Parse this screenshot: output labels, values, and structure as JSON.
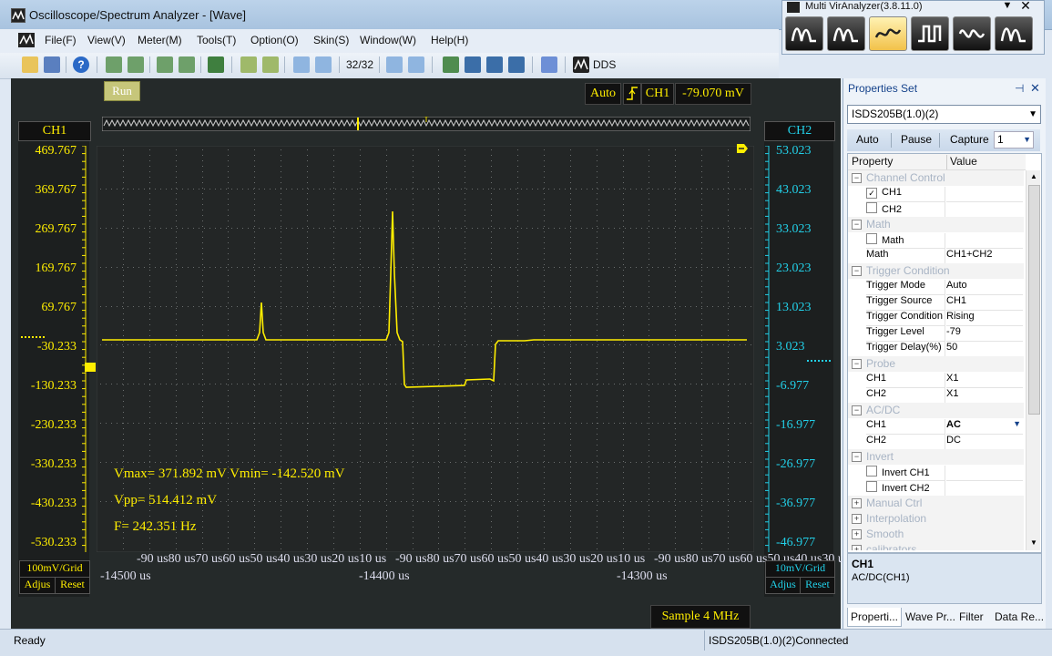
{
  "window": {
    "title": "Oscilloscope/Spectrum Analyzer - [Wave]"
  },
  "menu": [
    "File(F)",
    "View(V)",
    "Meter(M)",
    "Tools(T)",
    "Option(O)",
    "Skin(S)",
    "Window(W)",
    "Help(H)"
  ],
  "toolbar": {
    "page_counter": "32/32",
    "dds_label": "DDS"
  },
  "multivir": {
    "title": "Multi VirAnalyzer(3.8.11.0)"
  },
  "scope": {
    "run_label": "Run",
    "trigger_mode": "Auto",
    "trigger_channel": "CH1",
    "trigger_level": "-79.070 mV",
    "ch1_label": "CH1",
    "ch2_label": "CH2",
    "ch1_scale": [
      "469.767",
      "369.767",
      "269.767",
      "169.767",
      "69.767",
      "-30.233",
      "-130.233",
      "-230.233",
      "-330.233",
      "-430.233",
      "-530.233"
    ],
    "ch2_scale": [
      "53.023",
      "43.023",
      "33.023",
      "23.023",
      "13.023",
      "3.023",
      "-6.977",
      "-16.977",
      "-26.977",
      "-36.977",
      "-46.977"
    ],
    "ch1_grid": "100mV/Grid",
    "ch2_grid": "10mV/Grid",
    "adjust_label": "Adjus",
    "reset_label": "Reset",
    "x_ticks": "-90 us80 us70 us60 us50 us40 us30 us20 us10 us",
    "time_labels": [
      "-14500 us",
      "-14400 us",
      "-14300 us"
    ],
    "vmax_vmin": "Vmax= 371.892 mV  Vmin= -142.520 mV",
    "vpp": "Vpp= 514.412 mV",
    "freq": "F= 242.351 Hz",
    "sample_rate": "Sample 4 MHz",
    "colors": {
      "ch1": "#ffee00",
      "ch2": "#22d0e8",
      "grid_bg": "#232626"
    }
  },
  "properties": {
    "title": "Properties Set",
    "device": "ISDS205B(1.0)(2)",
    "auto_label": "Auto",
    "pause_label": "Pause",
    "capture_label": "Capture",
    "capture_value": "1",
    "col_property": "Property",
    "col_value": "Value",
    "rows": {
      "channel_control": "Channel Control",
      "ch1": "CH1",
      "ch2": "CH2",
      "math_cat": "Math",
      "math_check": "Math",
      "math": "Math",
      "math_val": "CH1+CH2",
      "trigger_cat": "Trigger Condition",
      "trigger_mode": "Trigger Mode",
      "trigger_mode_val": "Auto",
      "trigger_source": "Trigger Source",
      "trigger_source_val": "CH1",
      "trigger_condition": "Trigger Condition",
      "trigger_condition_val": "Rising",
      "trigger_level": "Trigger Level",
      "trigger_level_val": "-79",
      "trigger_delay": "Trigger Delay(%)",
      "trigger_delay_val": "50",
      "probe_cat": "Probe",
      "probe_ch1": "CH1",
      "probe_ch1_val": "X1",
      "probe_ch2": "CH2",
      "probe_ch2_val": "X1",
      "acdc_cat": "AC/DC",
      "acdc_ch1": "CH1",
      "acdc_ch1_val": "AC",
      "acdc_ch2": "CH2",
      "acdc_ch2_val": "DC",
      "invert_cat": "Invert",
      "invert_ch1": "Invert CH1",
      "invert_ch2": "Invert CH2",
      "manual_ctrl": "Manual Ctrl",
      "interpolation": "Interpolation",
      "smooth": "Smooth",
      "calibrators": "calibrators"
    },
    "desc_title": "CH1",
    "desc_text": "AC/DC(CH1)",
    "tabs": [
      "Properti...",
      "Wave Pr...",
      "Filter",
      "Data Re..."
    ]
  },
  "status": {
    "left": "Ready",
    "connection": "ISDS205B(1.0)(2)Connected"
  }
}
